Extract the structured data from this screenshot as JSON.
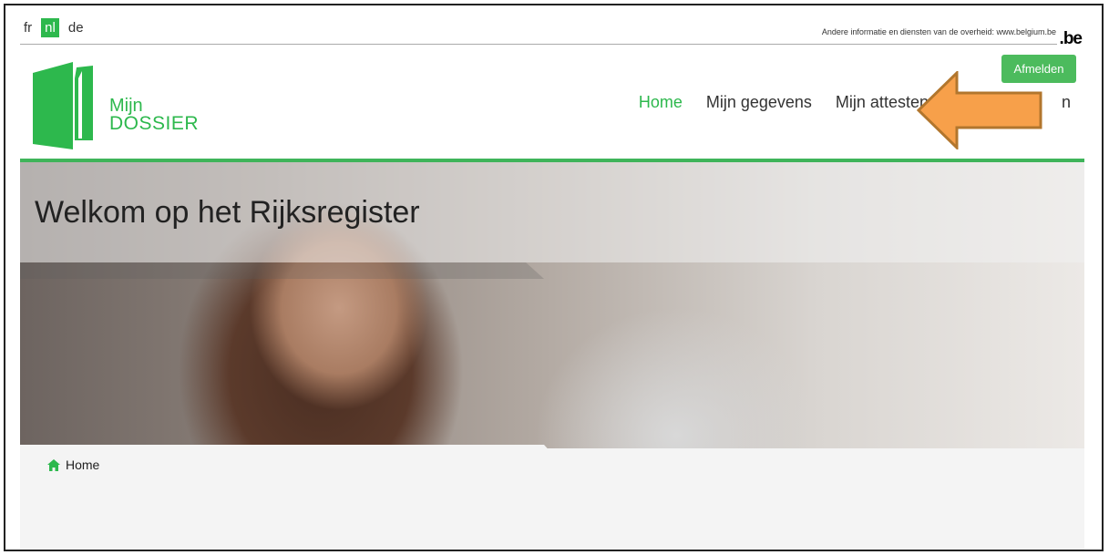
{
  "languages": [
    {
      "code": "fr",
      "active": false
    },
    {
      "code": "nl",
      "active": true
    },
    {
      "code": "de",
      "active": false
    }
  ],
  "federal_text": "Andere informatie en diensten van de overheid: www.belgium.be",
  "be_logo": ".be",
  "logout_label": "Afmelden",
  "logo": {
    "line1": "Mijn",
    "line2": "DOSSIER",
    "color": "#2db84d"
  },
  "nav": [
    {
      "label": "Home",
      "active": true
    },
    {
      "label": "Mijn gegevens",
      "active": false
    },
    {
      "label": "Mijn attesten",
      "active": false
    },
    {
      "label": "n",
      "active": false
    }
  ],
  "hero": {
    "title": "Welkom op het Rijksregister"
  },
  "breadcrumb": {
    "home_label": "Home"
  },
  "colors": {
    "accent": "#2db84d",
    "arrow": "#f7a04a",
    "arrow_border": "#b2762d"
  }
}
